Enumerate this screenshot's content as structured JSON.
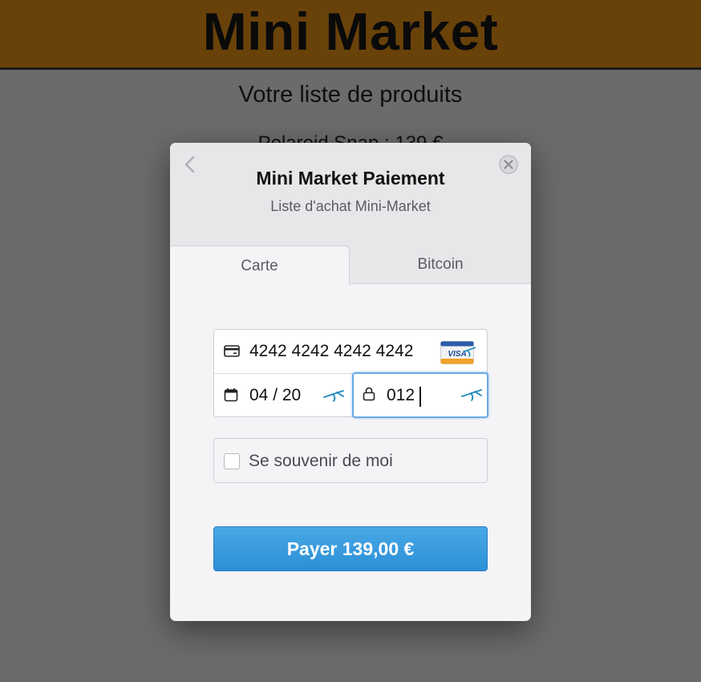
{
  "site": {
    "title": "Mini Market",
    "subtitle": "Votre liste de produits",
    "product_line": "Polaroid Snap : 139 €"
  },
  "modal": {
    "title": "Mini Market Paiement",
    "description": "Liste d'achat Mini-Market",
    "tabs": [
      {
        "label": "Carte",
        "active": true
      },
      {
        "label": "Bitcoin",
        "active": false
      }
    ],
    "card_number": "4242 4242 4242 4242",
    "expiry": "04 / 20",
    "cvc": "012",
    "card_brand": "VISA",
    "remember_label": "Se souvenir de moi",
    "remember_checked": false,
    "pay_label": "Payer 139,00 €"
  },
  "colors": {
    "header_bg": "#69420a",
    "overlay_bg": "#6b6b6b",
    "pay_button": "#3d9de0",
    "focus_border": "#6aa8e8"
  },
  "icons": [
    "back-chevron-icon",
    "close-icon",
    "credit-card-icon",
    "visa-card-icon",
    "calendar-icon",
    "lock-icon",
    "autofill-bird-icon"
  ]
}
